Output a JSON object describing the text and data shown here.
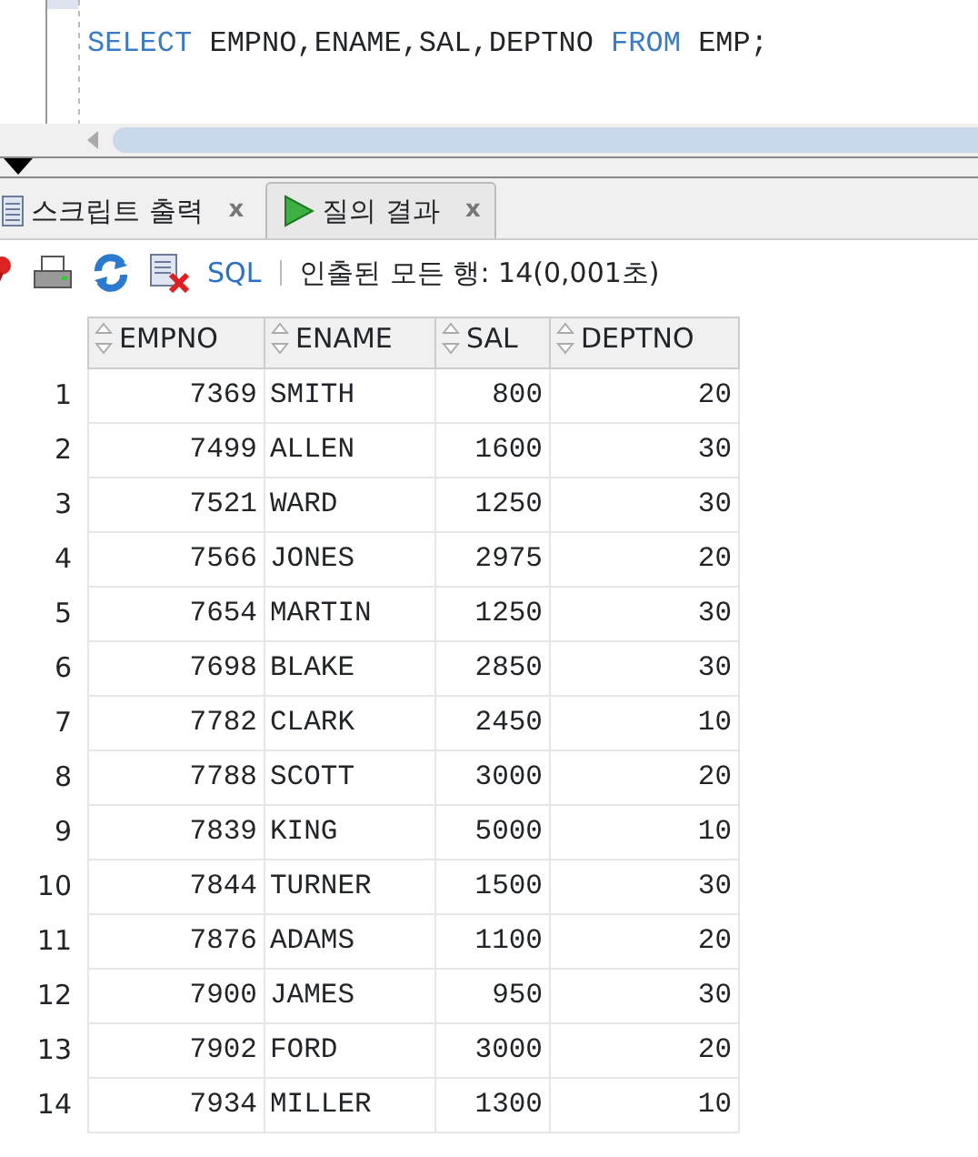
{
  "editor": {
    "tokens": [
      {
        "text": "SELECT",
        "kind": "keyword"
      },
      {
        "text": "EMPNO,ENAME,SAL,DEPTNO",
        "kind": "plain"
      },
      {
        "text": "FROM",
        "kind": "keyword"
      },
      {
        "text": "EMP;",
        "kind": "plain"
      }
    ]
  },
  "tabs": [
    {
      "label": "스크립트 출력",
      "close": "x",
      "selected": false
    },
    {
      "label": "질의 결과",
      "close": "x",
      "selected": true
    }
  ],
  "toolbar": {
    "sql_label": "SQL",
    "status": "인출된 모든 행: 14(0,001초)"
  },
  "table": {
    "columns": [
      {
        "label": "EMPNO",
        "kind": "number"
      },
      {
        "label": "ENAME",
        "kind": "text"
      },
      {
        "label": "SAL",
        "kind": "number"
      },
      {
        "label": "DEPTNO",
        "kind": "number"
      }
    ],
    "rows": [
      {
        "num": "1",
        "cells": [
          "7369",
          "SMITH",
          "800",
          "20"
        ]
      },
      {
        "num": "2",
        "cells": [
          "7499",
          "ALLEN",
          "1600",
          "30"
        ]
      },
      {
        "num": "3",
        "cells": [
          "7521",
          "WARD",
          "1250",
          "30"
        ]
      },
      {
        "num": "4",
        "cells": [
          "7566",
          "JONES",
          "2975",
          "20"
        ]
      },
      {
        "num": "5",
        "cells": [
          "7654",
          "MARTIN",
          "1250",
          "30"
        ]
      },
      {
        "num": "6",
        "cells": [
          "7698",
          "BLAKE",
          "2850",
          "30"
        ]
      },
      {
        "num": "7",
        "cells": [
          "7782",
          "CLARK",
          "2450",
          "10"
        ]
      },
      {
        "num": "8",
        "cells": [
          "7788",
          "SCOTT",
          "3000",
          "20"
        ]
      },
      {
        "num": "9",
        "cells": [
          "7839",
          "KING",
          "5000",
          "10"
        ]
      },
      {
        "num": "10",
        "cells": [
          "7844",
          "TURNER",
          "1500",
          "30"
        ]
      },
      {
        "num": "11",
        "cells": [
          "7876",
          "ADAMS",
          "1100",
          "20"
        ]
      },
      {
        "num": "12",
        "cells": [
          "7900",
          "JAMES",
          "950",
          "30"
        ]
      },
      {
        "num": "13",
        "cells": [
          "7902",
          "FORD",
          "3000",
          "20"
        ]
      },
      {
        "num": "14",
        "cells": [
          "7934",
          "MILLER",
          "1300",
          "10"
        ]
      }
    ]
  }
}
